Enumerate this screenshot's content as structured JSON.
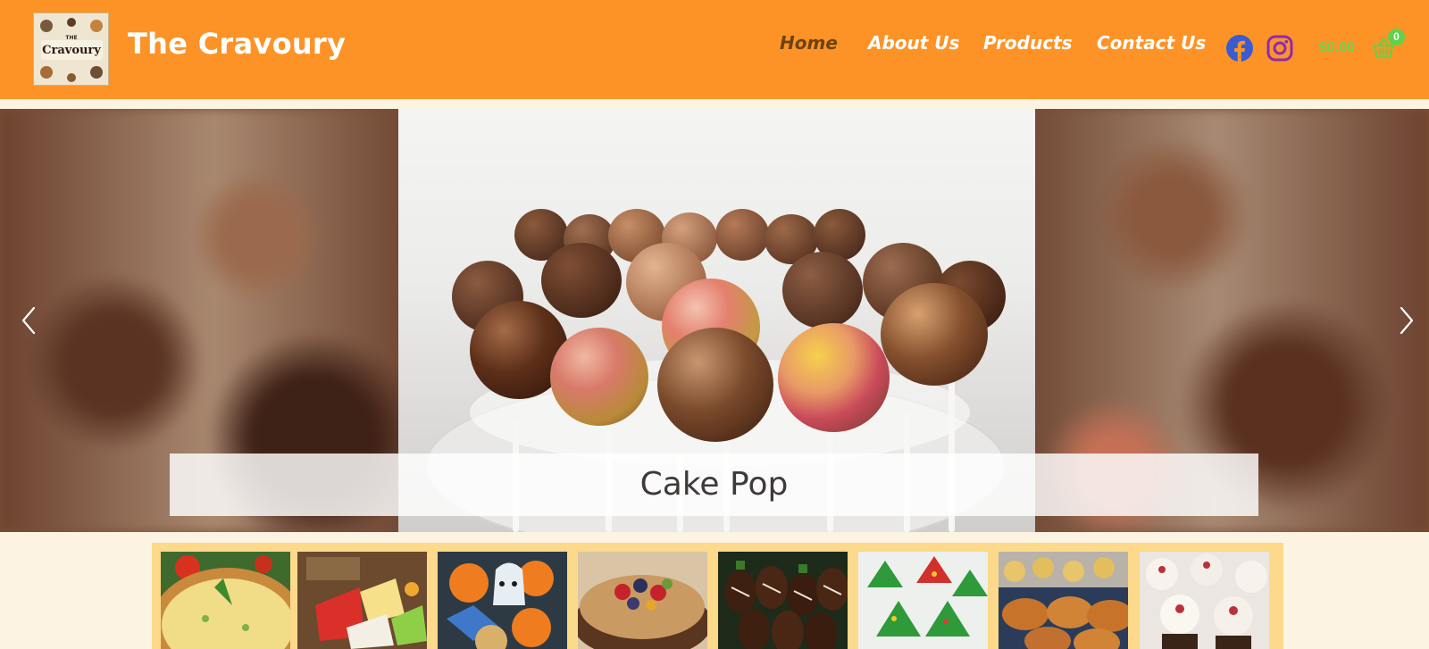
{
  "header": {
    "brand": "The Cravoury",
    "logo_text_small": "THE",
    "logo_text_big": "Cravoury",
    "nav": [
      {
        "label": "Home",
        "active": true
      },
      {
        "label": "About Us",
        "active": false
      },
      {
        "label": "Products",
        "active": false
      },
      {
        "label": "Contact Us",
        "active": false
      }
    ],
    "social": [
      "facebook-icon",
      "instagram-icon"
    ],
    "cart_total": "$0.00",
    "cart_count": "0",
    "colors": {
      "header": "#fd9326",
      "active_nav": "#6b4312",
      "cart": "#62d14a"
    }
  },
  "slider": {
    "caption": "Cake Pop",
    "prev_icon": "chevron-left-icon",
    "next_icon": "chevron-right-icon"
  },
  "thumbnails": [
    {
      "name": "quiche"
    },
    {
      "name": "cake-slices"
    },
    {
      "name": "halloween-cookies"
    },
    {
      "name": "fruit-pavlova"
    },
    {
      "name": "chocolate-strawberries"
    },
    {
      "name": "christmas-tree-treats"
    },
    {
      "name": "pastries"
    },
    {
      "name": "cupcakes"
    }
  ]
}
